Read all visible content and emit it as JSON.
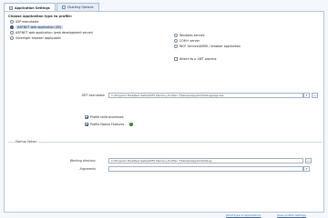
{
  "tabs": [
    {
      "label": "Application Settings",
      "active": true
    },
    {
      "label": "Charting Options",
      "active": false
    }
  ],
  "app_type": {
    "title": "Choose application type to profile:",
    "left_options": [
      {
        "label": "ASP executable",
        "selected": false
      },
      {
        "label": "ASP.NET web application (IIS)",
        "selected": true
      },
      {
        "label": "ASP.NET web application (web development server)",
        "selected": false
      },
      {
        "label": "Silverlight browser application",
        "selected": false
      }
    ],
    "right_options": [
      {
        "label": "Windows service",
        "selected": false
      },
      {
        "label": "COM+ server",
        "selected": false
      },
      {
        "label": "WCF Service/ASMX / browser application",
        "selected": false
      }
    ],
    "attach_check": {
      "label": "Attach to a .NET process",
      "checked": false
    }
  },
  "fields": {
    "exe_label": ".NET executable",
    "exe_value": "C:\\Program Files\\Red Gate\\ANTS Memory Profiler 7\\SampleApp\\bin\\Debug\\App.exe",
    "profile_child": {
      "label": "Profile child processes",
      "checked": true
    },
    "profile_native": {
      "label": "Profile Native Features",
      "checked": true
    }
  },
  "startup": {
    "group_title": "Startup Option",
    "working_dir_label": "Working directory",
    "working_dir_value": "C:\\Program Files\\Red Gate\\ANTS Memory Profiler 7\\SampleApp\\bin\\Debug",
    "arguments_label": "Arguments",
    "arguments_value": ""
  },
  "footer": {
    "link_left": "What type of application?",
    "link_right": "Save profiler settings"
  },
  "browse_label": "..."
}
